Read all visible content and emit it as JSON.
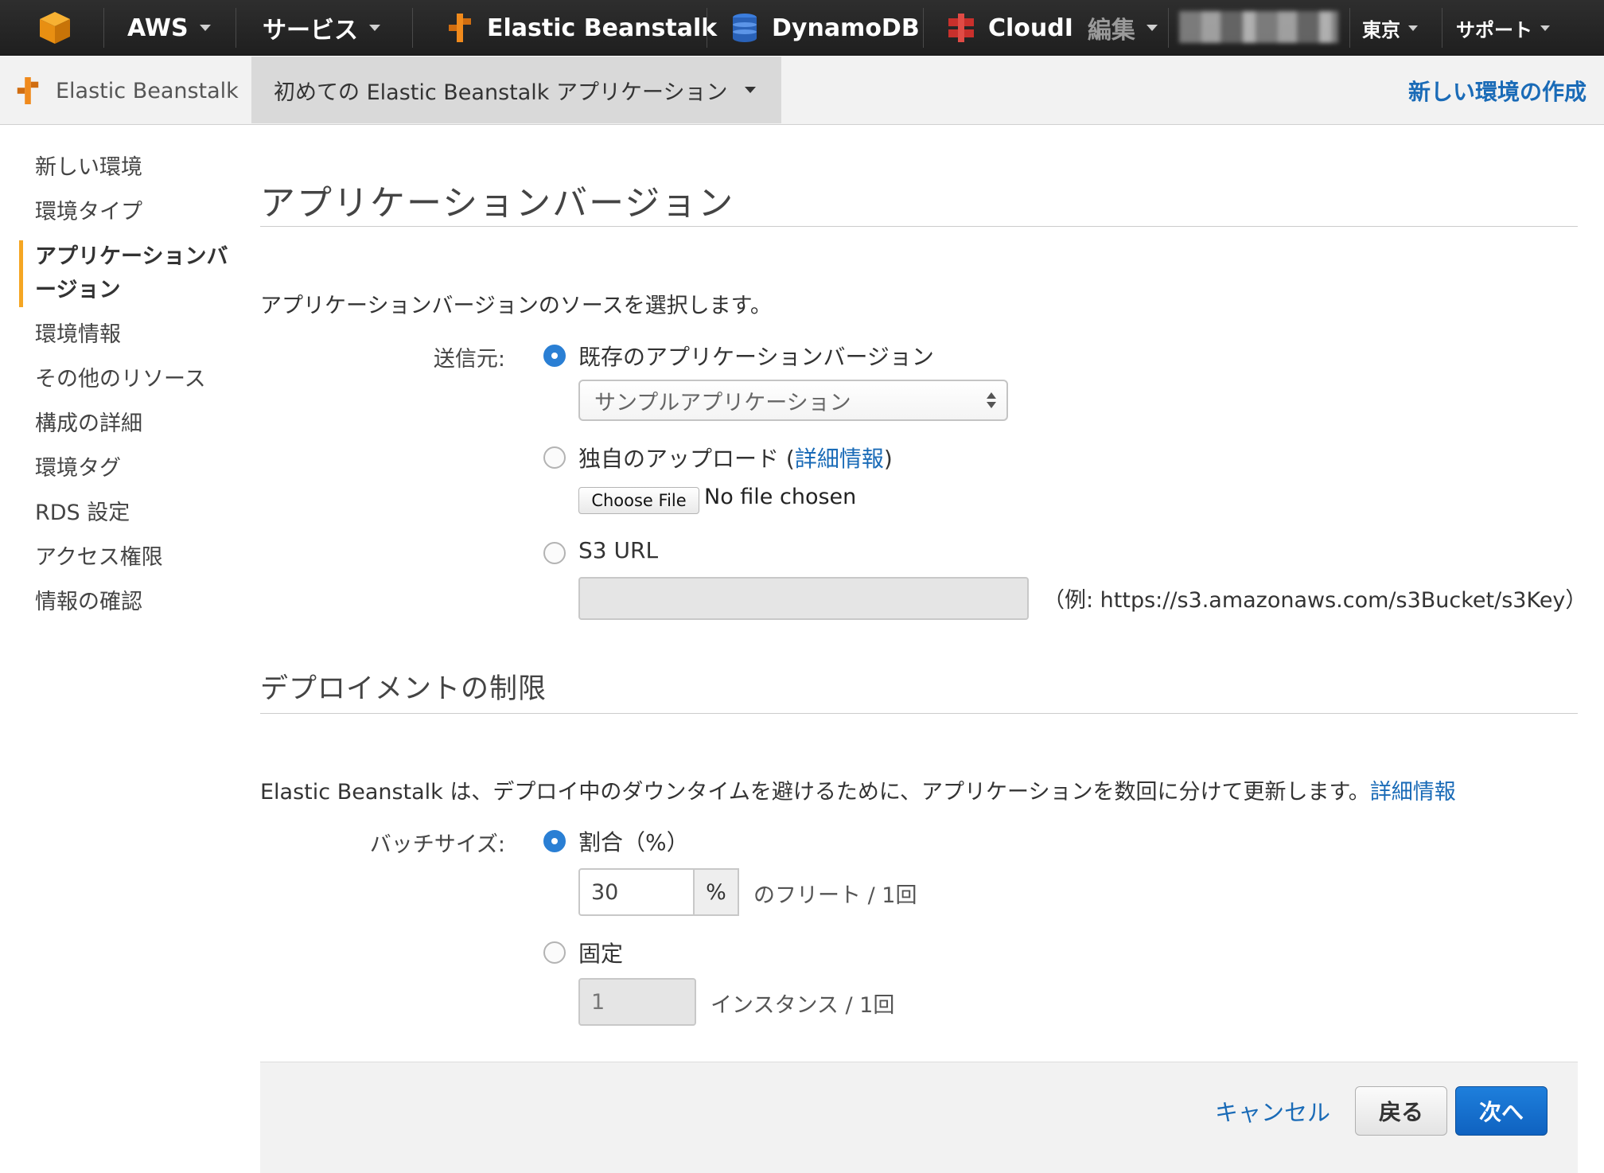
{
  "topnav": {
    "aws_label": "AWS",
    "services_label": "サービス",
    "shortcuts": [
      "Elastic Beanstalk",
      "DynamoDB",
      "CloudI"
    ],
    "edit_label": "編集",
    "region_label": "東京",
    "support_label": "サポート"
  },
  "subnav": {
    "brand_label": "Elastic Beanstalk",
    "app_selector_label": "初めての Elastic Beanstalk アプリケーション",
    "create_env_link": "新しい環境の作成"
  },
  "wizard_steps": [
    {
      "label": "新しい環境",
      "active": false
    },
    {
      "label": "環境タイプ",
      "active": false
    },
    {
      "label": "アプリケーションバージョン",
      "active": true
    },
    {
      "label": "環境情報",
      "active": false
    },
    {
      "label": "その他のリソース",
      "active": false
    },
    {
      "label": "構成の詳細",
      "active": false
    },
    {
      "label": "環境タグ",
      "active": false
    },
    {
      "label": "RDS 設定",
      "active": false
    },
    {
      "label": "アクセス権限",
      "active": false
    },
    {
      "label": "情報の確認",
      "active": false
    }
  ],
  "app_version": {
    "title": "アプリケーションバージョン",
    "description": "アプリケーションバージョンのソースを選択します。",
    "source_label": "送信元:",
    "existing_option": "既存のアプリケーションバージョン",
    "existing_selected": true,
    "existing_select_value": "サンプルアプリケーション",
    "upload_option": "独自のアップロード",
    "upload_open_paren": " (",
    "upload_more_info": "詳細情報",
    "upload_close_paren": ")",
    "choose_file_label": "Choose File",
    "file_status": "No file chosen",
    "s3_option": "S3 URL",
    "s3_value": "",
    "s3_example": "（例: https://s3.amazonaws.com/s3Bucket/s3Key）"
  },
  "deploy_limits": {
    "title": "デプロイメントの制限",
    "description": "Elastic Beanstalk は、デプロイ中のダウンタイムを避けるために、アプリケーションを数回に分けて更新します。",
    "more_info": "詳細情報",
    "batch_label": "バッチサイズ:",
    "percent_option": "割合（%）",
    "percent_selected": true,
    "percent_value": "30",
    "percent_addon": "%",
    "percent_unit": "のフリート / 1回",
    "fixed_option": "固定",
    "fixed_value": "1",
    "fixed_unit": "インスタンス / 1回"
  },
  "footer": {
    "cancel_label": "キャンセル",
    "back_label": "戻る",
    "next_label": "次へ"
  },
  "colors": {
    "topbar": "#232323",
    "accent": "#f5a623",
    "link": "#1a6bb7",
    "primary_button": "#1570d0"
  },
  "icons": [
    "aws-cube-icon",
    "beanstalk-icon",
    "dynamodb-icon",
    "cloud-service-icon",
    "select-arrows-icon"
  ]
}
